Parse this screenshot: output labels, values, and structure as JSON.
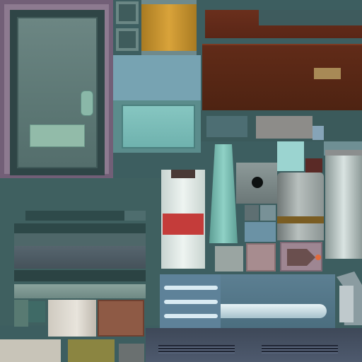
{
  "texture": {
    "regions": [
      "door-panel",
      "barrel",
      "wood-blocks",
      "teal-panel",
      "white-canister",
      "glass-tube",
      "metal-bracket",
      "metal-canister",
      "right-cylinder",
      "arrow-sign",
      "machine-housing",
      "blade-panel",
      "vent-panel"
    ],
    "colors": {
      "background": "#3d5e60",
      "door": "#6c8683",
      "barrel": "#d9a33a",
      "wood": "#5a2617",
      "teal": "#86c6c1",
      "red_band": "#c43c3a",
      "blade": "#e8f3f6"
    }
  }
}
